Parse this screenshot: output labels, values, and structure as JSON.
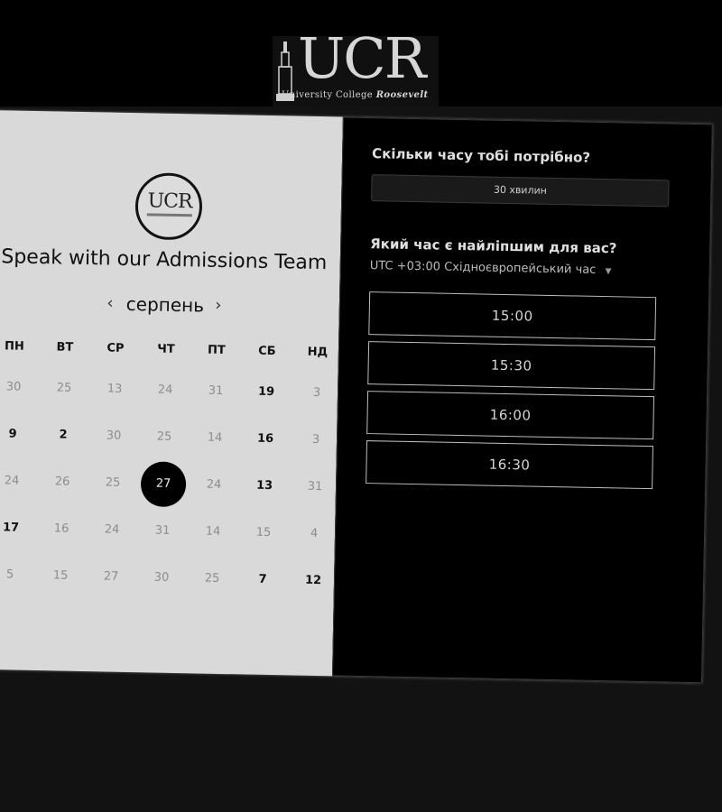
{
  "logo": {
    "letters": "UCR",
    "subtitle_regular": "University College",
    "subtitle_bold": "Roosevelt"
  },
  "left": {
    "logo_letters": "UCR",
    "title": "Speak with our Admissions Team",
    "month": "серпень",
    "prev_arrow": "‹",
    "next_arrow": "›",
    "weekdays": [
      "ПН",
      "ВТ",
      "СР",
      "ЧТ",
      "ПТ",
      "СБ",
      "НД"
    ],
    "days": [
      [
        "30",
        "25",
        "13",
        "24",
        "31",
        "19",
        "3"
      ],
      [
        "9",
        "2",
        "30",
        "25",
        "14",
        "16",
        "3"
      ],
      [
        "24",
        "26",
        "25",
        "27",
        "24",
        "13",
        "31"
      ],
      [
        "17",
        "16",
        "24",
        "31",
        "14",
        "15",
        "4"
      ],
      [
        "5",
        "15",
        "27",
        "30",
        "25",
        "7",
        "12"
      ]
    ],
    "active_days": [
      [
        0,
        5
      ],
      [
        1,
        0
      ],
      [
        1,
        1
      ],
      [
        1,
        5
      ],
      [
        2,
        5
      ],
      [
        3,
        0
      ],
      [
        4,
        5
      ],
      [
        4,
        6
      ]
    ],
    "selected_day": [
      2,
      3
    ]
  },
  "right": {
    "duration_question": "Скільки часу тобі потрібно?",
    "duration_value": "30 хвилин",
    "time_question": "Який час є найліпшим для вас?",
    "timezone": "UTC +03:00 Східноєвропейський час",
    "slots": [
      "15:00",
      "15:30",
      "16:00",
      "16:30"
    ]
  },
  "colors": {
    "page_bg": "#121212",
    "left_panel": "#d9d9d9",
    "right_panel": "#000000",
    "selected_day": "#000000"
  }
}
